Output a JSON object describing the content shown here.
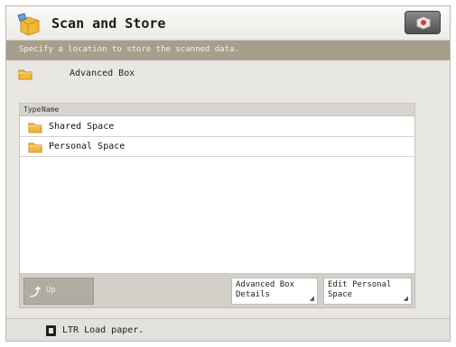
{
  "window": {
    "title": "Scan and Store",
    "title_icon": "scan-store-icon",
    "corner_button_icon": "status-monitor-icon"
  },
  "instruction": "Specify a location to store the scanned data.",
  "location": {
    "label": "Advanced Box",
    "icon": "folder-icon"
  },
  "list": {
    "headers": {
      "type": "Type",
      "name": "Name"
    },
    "items": [
      {
        "label": "Shared Space",
        "icon": "folder-icon"
      },
      {
        "label": "Personal Space",
        "icon": "folder-icon"
      }
    ]
  },
  "buttons": {
    "up": "Up",
    "up_icon": "up-arrow-icon",
    "details": "Advanced Box\nDetails",
    "edit": "Edit Personal\nSpace"
  },
  "status": {
    "paper_icon": "paper-icon",
    "text": "LTR  Load paper."
  },
  "colors": {
    "instruction_bar": "#a79f8c",
    "folder": "#f0b93a",
    "background": "#e9e7e2"
  }
}
